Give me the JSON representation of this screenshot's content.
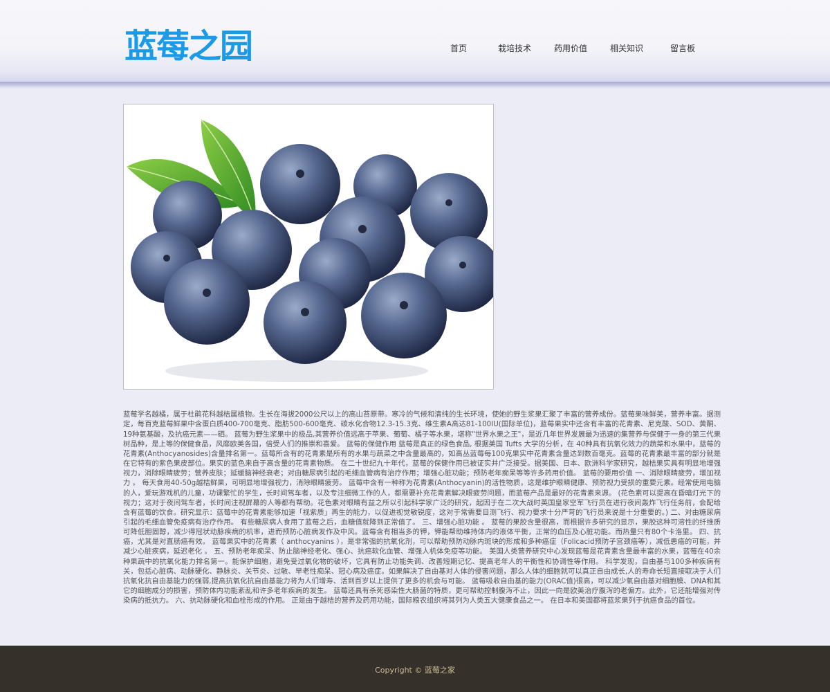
{
  "header": {
    "logo_text": "蓝莓之园",
    "nav": [
      "首页",
      "栽培技术",
      "药用价值",
      "相关知识",
      "留言板"
    ]
  },
  "colors": {
    "brand_blue": "#1b9ae6",
    "page_background": "#ececf7",
    "footer_background": "#353029",
    "footer_text": "#c9bd96"
  },
  "main": {
    "image_icon": "blueberries-photo",
    "article": "蓝莓学名越橘，属于杜鹃花科越桔属植物。生长在海拔2000公尺以上的高山苔原带。寒冷的气候和清纯的生长环境，使她的野生浆果汇聚了丰富的营养成份。蓝莓果味鲜美，营养丰富。据测定，每百克蓝莓鲜果中含蛋白质400-700毫克、脂肪500-600毫克、碳水化合物12.3-15.3克、维生素A高达81-100IU(国际单位)，蓝莓果实中还含有丰富的花青素、尼克酸、SOD、黄酮、19种氨基酸，及抗癌元素——硒。 蓝莓为野生浆果中的极品,其营养价值远高于苹果、葡萄、橘子等水果，堪称\"世界水果之王\"，是近几年世界发展最为迅速的集营养与保健于一身的第三代果树品种，是上等的保健食品，风靡欧美各国，倍受人们的推崇和喜爱。 蓝莓的保健作用 蓝莓是真正的绿色食品, 根据美国 Tufts 大学的分析，在 40种具有抗氧化效力的蔬菜和水果中，蓝莓的花青素(Anthocyanosides)含量排名第一。蓝莓所含有的花青素是所有的水果与蔬菜之中含量最高的，如高丛蓝莓每100克果实中花青素含量达到数百毫克。蓝莓的花青素最丰富的部分就是在它特有的紫色果皮部位。果实的蓝色来自于高含量的花青素物质。 在二十世纪九十年代，蓝莓的保健作用已被证实并广泛接受。据美国、日本、欧洲科学家研究，越桔果实具有明显地增强视力，消除眼睛疲劳；营养皮肤；延缓脑神经衰老；对由糖尿病引起的毛细血管病有治疗作用；增强心脏功能；预防老年痴呆等等许多药用价值。 蓝莓的要用价值 一、消除眼睛疲劳，增加视力 。 每天食用40-50g越桔鲜果，可明显地增强视力，消除眼睛疲劳。 蓝莓中含有一种称为花青素(Anthocyanin)的活性物质，这是维护眼睛健康、预防视力受损的重要元素。经常使用电脑的人，爱玩游戏机的儿童，功课繁忙的学生，长时间驾车者，以及专注细微工作的人，都需要补充花青素解决眼疲劳问题，而蓝莓产品是最好的花青素来源。 (花色素可以提高在昏暗灯光下的视力；这对于夜间驾车者，长时间注视屏幕的人等都有帮助。花色素对眼睛有益之所以引起科学家广泛的研究，起因于在二次大战时英国皇家空军飞行员在进行夜间轰炸飞行任务前，会配给含有蓝莓的饮食。研究显示：蓝莓中的花青素能够加速「视紫质」再生的能力，以促进视觉敏锐度，这对于常需要目测飞行、视力要求十分严苛的飞行员来说是十分重要的。) 二、对由糖尿病引起的毛细血管免疫病有治疗作用。 有些糖尿病人食用了蓝莓之后，血糖值就降到正常值了。 三、增强心脏功能 。 蓝莓的果胶含量很高，而根据许多研究的显示，果胶这种可溶性的纤维质可降低胆固醇，减少得冠状动脉疾病的机率，进而预防心脏病发作及中风。蓝莓含有相当多的钾，钾能帮助维持体内的液体平衡，正常的血压及心脏功能。而热量只有80个卡洛里。 四、抗癌，尤其是对直肠癌有效。 蓝莓果实中的花青素（ anthocyanins ），是非常强的抗氧化剂，可以帮助预防动脉内斑块的形成和多种癌症（Folicacid预防子宫颈癌等），减低患癌的可能，并减少心脏疾病，延迟老化 。 五、预防老年痴呆、防止脑神经老化、强心、抗癌软化血管、增强人机体免疫等功能。 美国人类营养研究中心发现蓝莓是花青素含量最丰富的水果，蓝莓在40余种果蔬中的抗氧化能力排名第一。能保护细胞，避免受过氧化物的破坏，它具有防止功能失调、改善短期记忆、提高老年人的平衡性和协调性等作用。 科学发现，自由基与100多种疾病有关，包括心脏病、动脉硬化、静脉炎、关节炎、过敏、早老性痴呆、冠心病及癌症。如果解决了自由基对人体的侵害问题，那么人体的细胞就可以真正自由成长,人的寿命长短直接取决于人们抗氧化抗自由基能力的强弱,提高抗氧化抗自由基能力将为人们增寿、活到百岁以上提供了更多的机会与可能。 蓝莓吸收自由基的能力(ORAC值)很高，可以减少氧自由基对细胞膜、DNA和其它的细胞成分的损害，预防体内功能紊乱和许多老年疾病的发生。 蓝莓还具有杀死感染性大肠菌的特质，更可帮助控制腹泻不止，因此一向是欧美治疗腹泻的老偏方。此外，它还能增强对传染病的抵抗力。 六、抗动脉硬化和血栓形成的作用。 正是由于越桔的营养及药用功能，国际粮农组织将其列为人类五大健康食品之一。 在日本和美国都将蓝浆果列于抗癌食品的首位。"
  },
  "footer": {
    "copyright": "Copyright © 蓝莓之家"
  }
}
